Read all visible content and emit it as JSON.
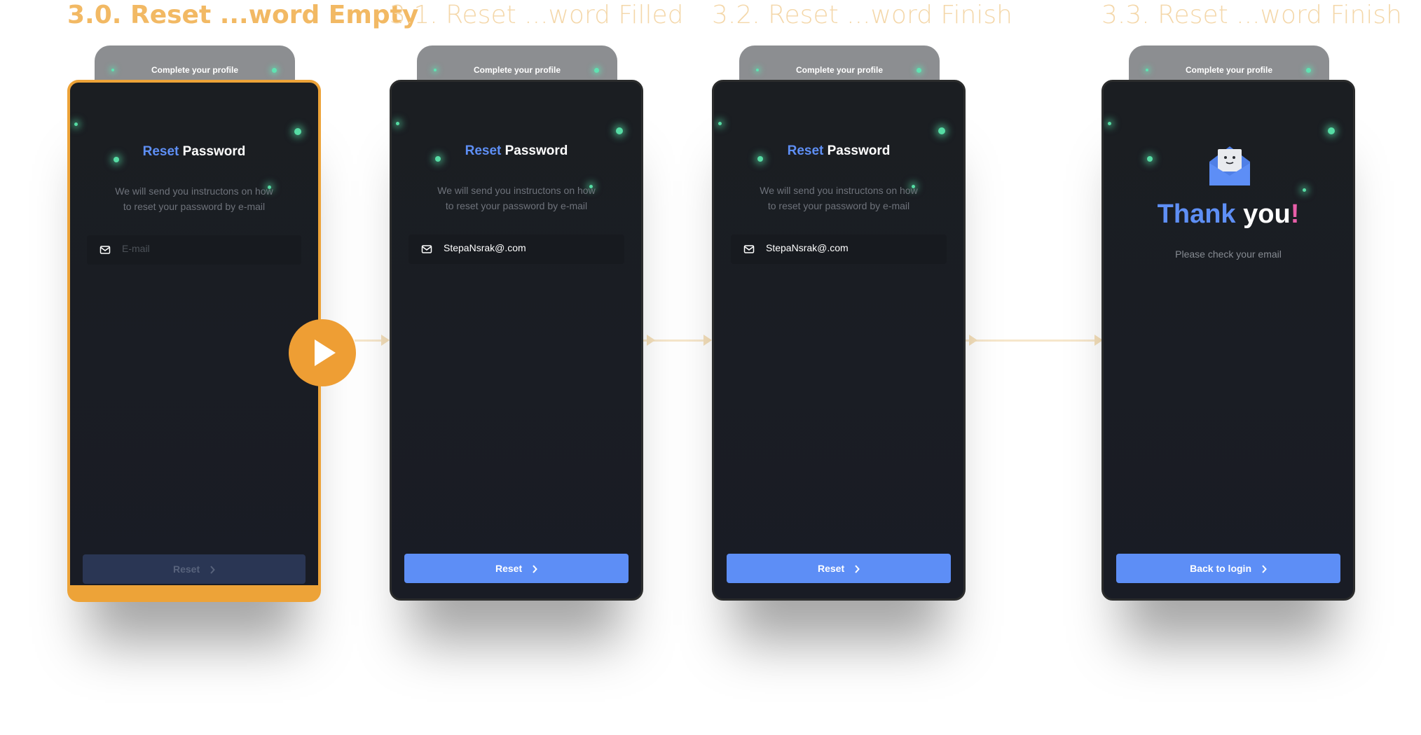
{
  "frames": [
    {
      "title": "3.0. Reset ...word Empty",
      "selected": true
    },
    {
      "title": "3.1. Reset ...word Filled",
      "selected": false
    },
    {
      "title": "3.2. Reset ...word Finish",
      "selected": false
    },
    {
      "title": "3.3. Reset ...word Finish",
      "selected": false
    }
  ],
  "tab": {
    "label": "Complete your profile"
  },
  "reset": {
    "title_accent": "Reset",
    "title_rest": "Password",
    "description_line1": "We will send you instructons on how",
    "description_line2": "to reset your password by e-mail",
    "email_placeholder": "E-mail",
    "email_value": "StepaNsrak@.com",
    "button_label": "Reset"
  },
  "thanks": {
    "title_accent": "Thank",
    "title_rest": "you",
    "title_mark": "!",
    "message": "Please check your email",
    "button_label": "Back to login"
  },
  "colors": {
    "accent_blue": "#5d8ef6",
    "selection_orange": "#eda338",
    "glow_green": "#56dca4",
    "frame_title_inactive": "#f4d7a9"
  },
  "icons": {
    "mail": "mail-icon",
    "chevron": "chevron-right-icon",
    "play": "play-icon",
    "envelope": "envelope-illustration"
  }
}
